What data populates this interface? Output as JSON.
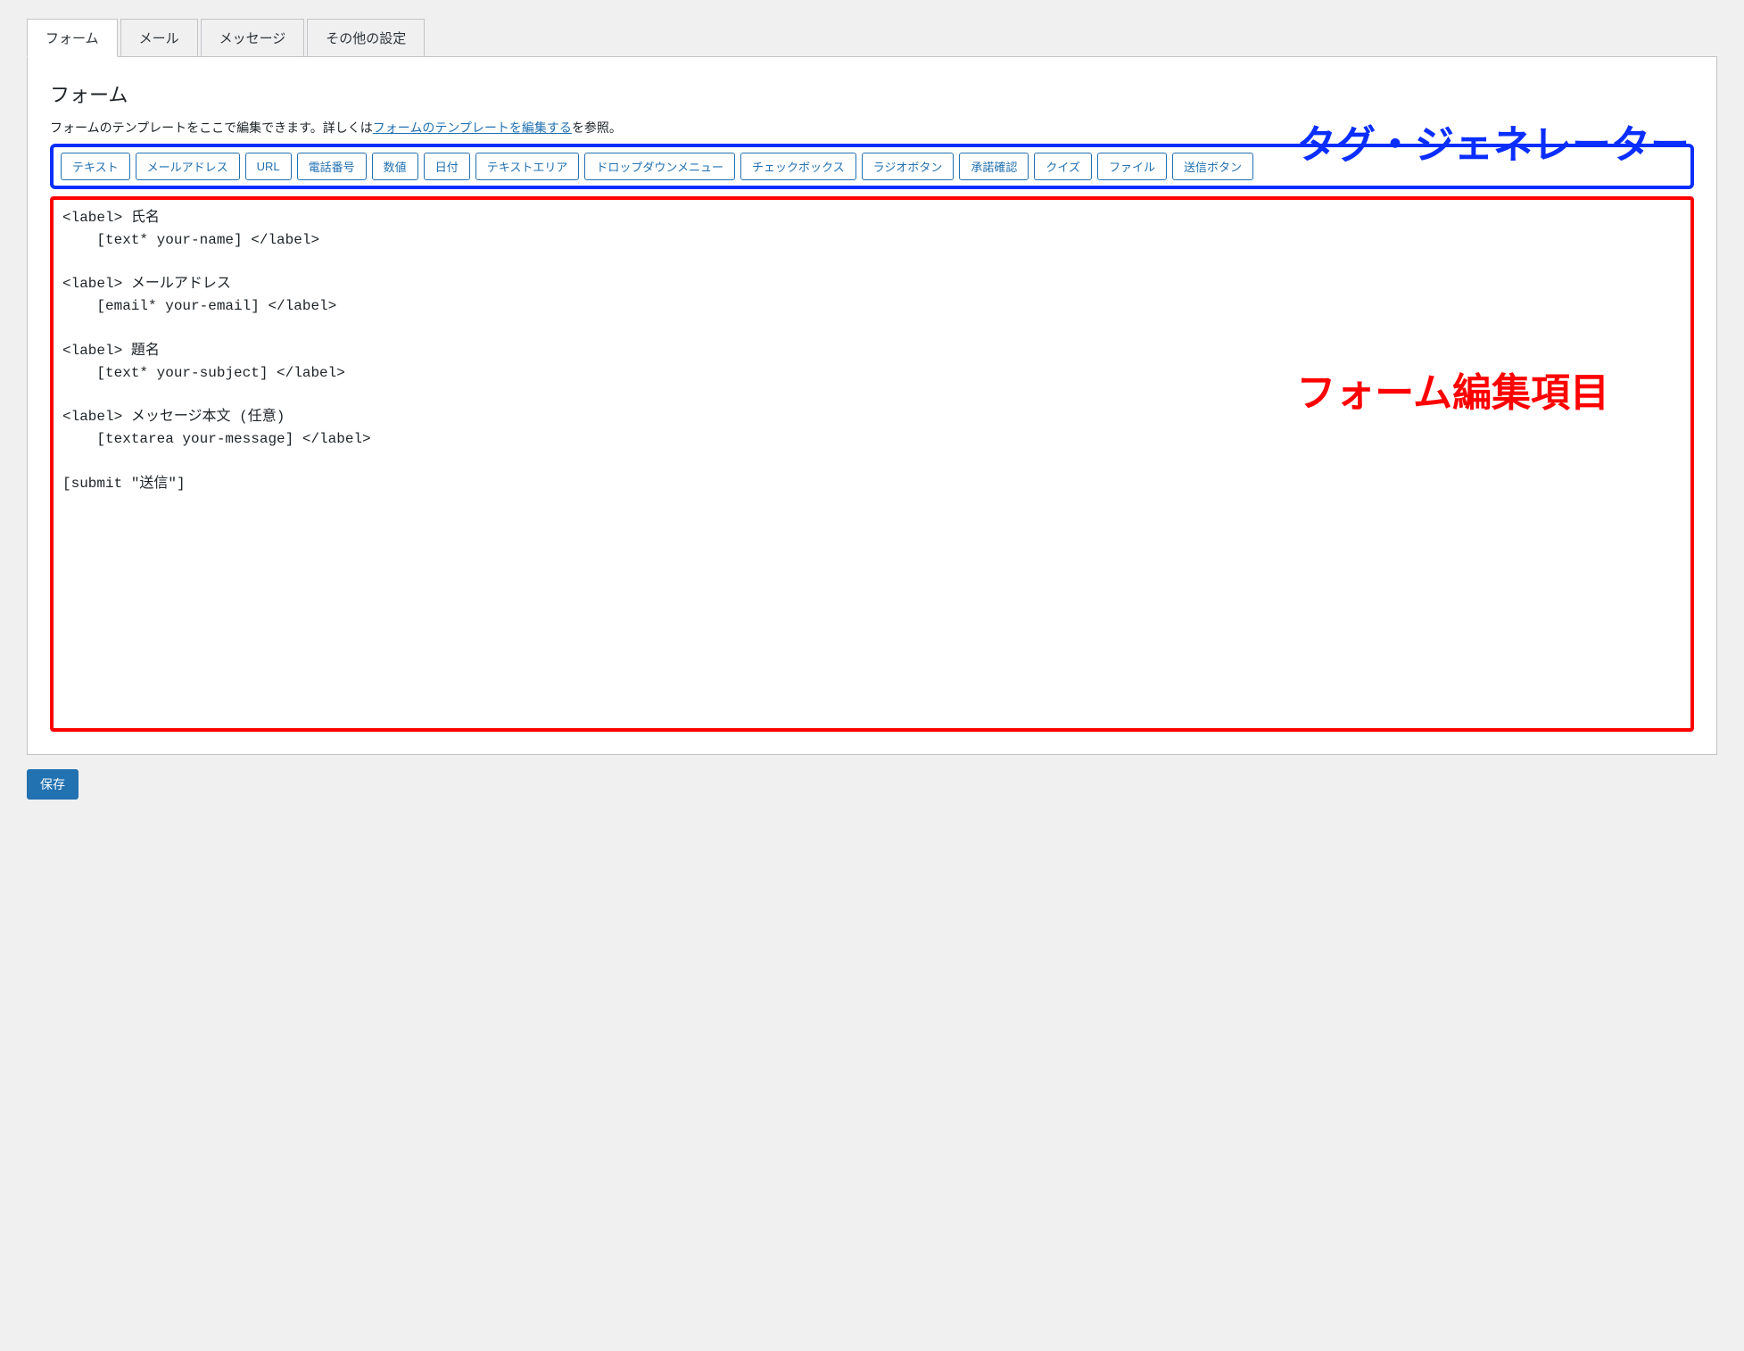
{
  "tabs": {
    "form": "フォーム",
    "mail": "メール",
    "message": "メッセージ",
    "other": "その他の設定"
  },
  "panel": {
    "title": "フォーム",
    "description_prefix": "フォームのテンプレートをここで編集できます。詳しくは",
    "help_link_text": "フォームのテンプレートを編集する",
    "description_suffix": "を参照。"
  },
  "tag_generator": {
    "buttons": {
      "text": "テキスト",
      "email": "メールアドレス",
      "url": "URL",
      "tel": "電話番号",
      "number": "数値",
      "date": "日付",
      "textarea": "テキストエリア",
      "dropdown": "ドロップダウンメニュー",
      "checkbox": "チェックボックス",
      "radio": "ラジオボタン",
      "acceptance": "承諾確認",
      "quiz": "クイズ",
      "file": "ファイル",
      "submit": "送信ボタン"
    }
  },
  "form_editor_content": "<label> 氏名\n    [text* your-name] </label>\n\n<label> メールアドレス\n    [email* your-email] </label>\n\n<label> 題名\n    [text* your-subject] </label>\n\n<label> メッセージ本文 (任意)\n    [textarea your-message] </label>\n\n[submit \"送信\"]",
  "save_button": "保存",
  "annotations": {
    "tag_generator_label": "タグ・ジェネレーター",
    "form_editor_label": "フォーム編集項目"
  }
}
